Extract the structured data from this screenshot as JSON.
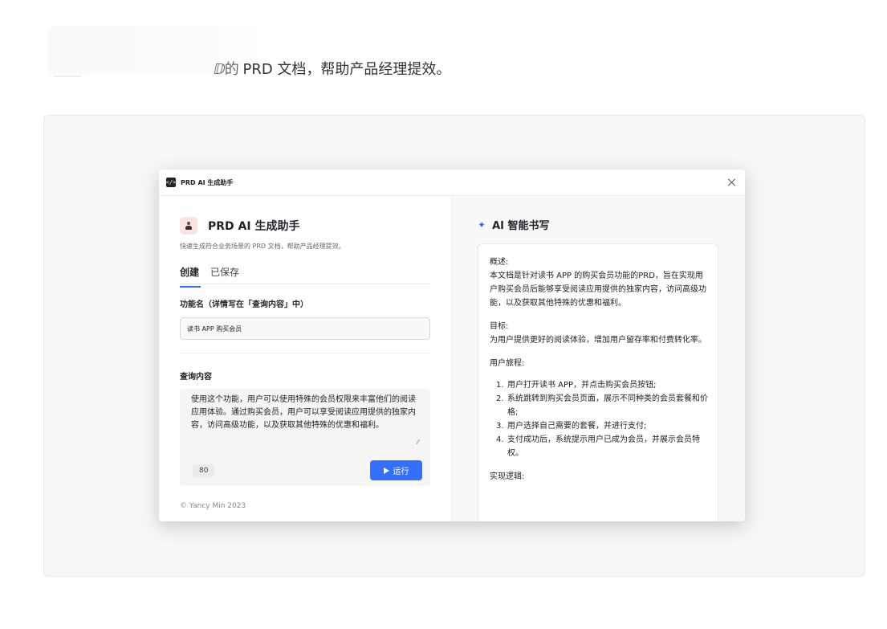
{
  "page": {
    "caption_prefix": "ⅅ的",
    "caption": " PRD 文档，帮助产品经理提效。"
  },
  "window": {
    "icon_text": "</>",
    "app_name": "PRD AI 生成助手"
  },
  "left": {
    "title": "PRD AI 生成助手",
    "subtitle": "快速生成符合业务场景的 PRD 文档，帮助产品经理提效。",
    "tabs": [
      {
        "label": "创建"
      },
      {
        "label": "已保存"
      }
    ],
    "feature_label": "功能名（详情写在「查询内容」中）",
    "feature_value": "读书 APP 购买会员",
    "query_label": "查询内容",
    "query_text": "使用这个功能，用户可以使用特殊的会员权限来丰富他们的阅读应用体验。通过购买会员，用户可以享受阅读应用提供的独家内容，访问高级功能，以及获取其他特殊的优惠和福利。",
    "char_count": "80",
    "run_label": "运行",
    "footer": "© Yancy Min 2023"
  },
  "right": {
    "title": "AI 智能书写",
    "overview_heading": "概述:",
    "overview_text": "本文档是针对读书 APP 的购买会员功能的PRD，旨在实现用户购买会员后能够享受阅读应用提供的独家内容，访问高级功能，以及获取其他特殊的优惠和福利。",
    "goal_heading": "目标:",
    "goal_text": "为用户提供更好的阅读体验，增加用户留存率和付费转化率。",
    "journey_heading": "用户旅程:",
    "journey": [
      {
        "num": "1.",
        "text": "用户打开读书 APP，并点击购买会员按钮;"
      },
      {
        "num": "2.",
        "text": "系统跳转到购买会员页面，展示不同种类的会员套餐和价格;"
      },
      {
        "num": "3.",
        "text": "用户选择自己需要的套餐，并进行支付;"
      },
      {
        "num": "4.",
        "text": "支付成功后，系统提示用户已成为会员，并展示会员特权。"
      }
    ],
    "impl_heading": "实现逻辑:"
  }
}
